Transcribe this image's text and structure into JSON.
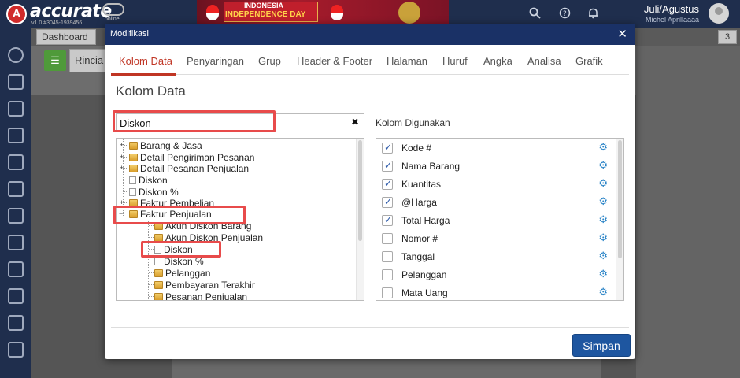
{
  "app": {
    "logo_mark": "A",
    "logo_text": "accurate",
    "logo_online": "online",
    "version": "v1.0.#3045-1939456",
    "banner_line1": "INDONESIA",
    "banner_line2": "INDEPENDENCE DAY",
    "user_period": "Juli/Agustus",
    "user_name": "Michel Aprillaaaa",
    "top_icons": [
      "search-icon",
      "help-icon",
      "bell-icon"
    ],
    "tab_dashboard": "Dashboard",
    "tab_counter": "3",
    "toolbar_icon": "list-icon",
    "tab_rincian": "Rincia"
  },
  "modal": {
    "title": "Modifikasi",
    "close_glyph": "✕",
    "tabs": [
      "Kolom Data",
      "Penyaringan",
      "Grup",
      "Header & Footer",
      "Halaman",
      "Huruf",
      "Angka",
      "Analisa",
      "Grafik"
    ],
    "active_tab": "Kolom Data",
    "section_title": "Kolom Data",
    "search": {
      "value": "Diskon",
      "clear_glyph": "✖"
    },
    "tree": [
      {
        "label": "Barang & Jasa",
        "type": "folder",
        "level": 0
      },
      {
        "label": "Detail Pengiriman Pesanan",
        "type": "folder",
        "level": 0
      },
      {
        "label": "Detail Pesanan Penjualan",
        "type": "folder",
        "level": 0
      },
      {
        "label": "Diskon",
        "type": "doc",
        "level": 0
      },
      {
        "label": "Diskon %",
        "type": "doc",
        "level": 0
      },
      {
        "label": "Faktur Pembelian",
        "type": "folder",
        "level": 0
      },
      {
        "label": "Faktur Penjualan",
        "type": "folder",
        "level": 0,
        "expanded": true
      },
      {
        "label": "Akun Diskon Barang",
        "type": "folder",
        "level": 1
      },
      {
        "label": "Akun Diskon Penjualan",
        "type": "folder",
        "level": 1
      },
      {
        "label": "Diskon",
        "type": "doc",
        "level": 1
      },
      {
        "label": "Diskon %",
        "type": "doc",
        "level": 1
      },
      {
        "label": "Pelanggan",
        "type": "folder",
        "level": 1
      },
      {
        "label": "Pembayaran Terakhir",
        "type": "folder",
        "level": 1
      },
      {
        "label": "Pesanan Penjualan",
        "type": "folder",
        "level": 1
      }
    ],
    "columns_label": "Kolom Digunakan",
    "columns": [
      {
        "label": "Kode #",
        "checked": true
      },
      {
        "label": "Nama Barang",
        "checked": true
      },
      {
        "label": "Kuantitas",
        "checked": true
      },
      {
        "label": "@Harga",
        "checked": true
      },
      {
        "label": "Total Harga",
        "checked": true
      },
      {
        "label": "Nomor #",
        "checked": false
      },
      {
        "label": "Tanggal",
        "checked": false
      },
      {
        "label": "Pelanggan",
        "checked": false
      },
      {
        "label": "Mata Uang",
        "checked": false
      }
    ],
    "gear_glyph": "⚙",
    "save_label": "Simpan"
  },
  "colors": {
    "header_bg": "#1a3166",
    "active_tab": "#c03524",
    "highlight": "#e84b4b",
    "save_button": "#1e56a0",
    "gear": "#2a84c7"
  }
}
